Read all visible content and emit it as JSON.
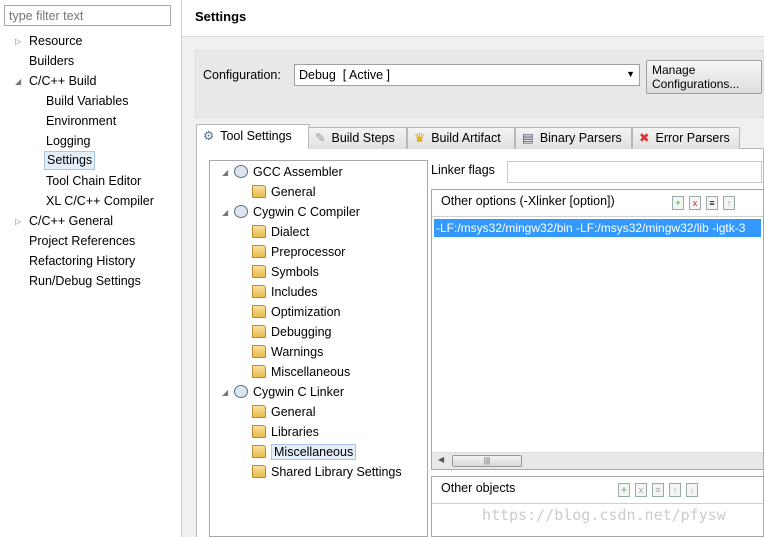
{
  "filter": {
    "placeholder": "type filter text"
  },
  "nav": [
    {
      "label": "Resource",
      "level": 0,
      "twisty": "collapsed"
    },
    {
      "label": "Builders",
      "level": 0,
      "twisty": ""
    },
    {
      "label": "C/C++ Build",
      "level": 0,
      "twisty": "expanded"
    },
    {
      "label": "Build Variables",
      "level": 1
    },
    {
      "label": "Environment",
      "level": 1
    },
    {
      "label": "Logging",
      "level": 1
    },
    {
      "label": "Settings",
      "level": 1,
      "selected": true
    },
    {
      "label": "Tool Chain Editor",
      "level": 1
    },
    {
      "label": "XL C/C++ Compiler",
      "level": 1
    },
    {
      "label": "C/C++ General",
      "level": 0,
      "twisty": "collapsed"
    },
    {
      "label": "Project References",
      "level": 0
    },
    {
      "label": "Refactoring History",
      "level": 0
    },
    {
      "label": "Run/Debug Settings",
      "level": 0
    }
  ],
  "header": {
    "title": "Settings"
  },
  "configuration": {
    "label": "Configuration:",
    "value": "Debug  [ Active ]",
    "manage_label": "Manage Configurations..."
  },
  "tabs": [
    {
      "label": "Tool Settings",
      "icon": "gear-icon",
      "active": true
    },
    {
      "label": "Build Steps",
      "icon": "wand-icon"
    },
    {
      "label": "Build Artifact",
      "icon": "trophy-icon"
    },
    {
      "label": "Binary Parsers",
      "icon": "binary-icon"
    },
    {
      "label": "Error Parsers",
      "icon": "error-icon"
    }
  ],
  "tool_tree": [
    {
      "label": "GCC Assembler",
      "level": 0
    },
    {
      "label": "General",
      "level": 1
    },
    {
      "label": "Cygwin C Compiler",
      "level": 0
    },
    {
      "label": "Dialect",
      "level": 1
    },
    {
      "label": "Preprocessor",
      "level": 1
    },
    {
      "label": "Symbols",
      "level": 1
    },
    {
      "label": "Includes",
      "level": 1
    },
    {
      "label": "Optimization",
      "level": 1
    },
    {
      "label": "Debugging",
      "level": 1
    },
    {
      "label": "Warnings",
      "level": 1
    },
    {
      "label": "Miscellaneous",
      "level": 1
    },
    {
      "label": "Cygwin C Linker",
      "level": 0
    },
    {
      "label": "General",
      "level": 1
    },
    {
      "label": "Libraries",
      "level": 1
    },
    {
      "label": "Miscellaneous",
      "level": 1,
      "selected": true
    },
    {
      "label": "Shared Library Settings",
      "level": 1
    }
  ],
  "linker_flags": {
    "label": "Linker flags",
    "value": ""
  },
  "other_options": {
    "title": "Other options (-Xlinker [option])",
    "items": [
      "-LF:/msys32/mingw32/bin -LF:/msys32/mingw32/lib -lgtk-3"
    ]
  },
  "other_objects": {
    "title": "Other objects"
  },
  "watermark": "https://blog.csdn.net/pfysw"
}
